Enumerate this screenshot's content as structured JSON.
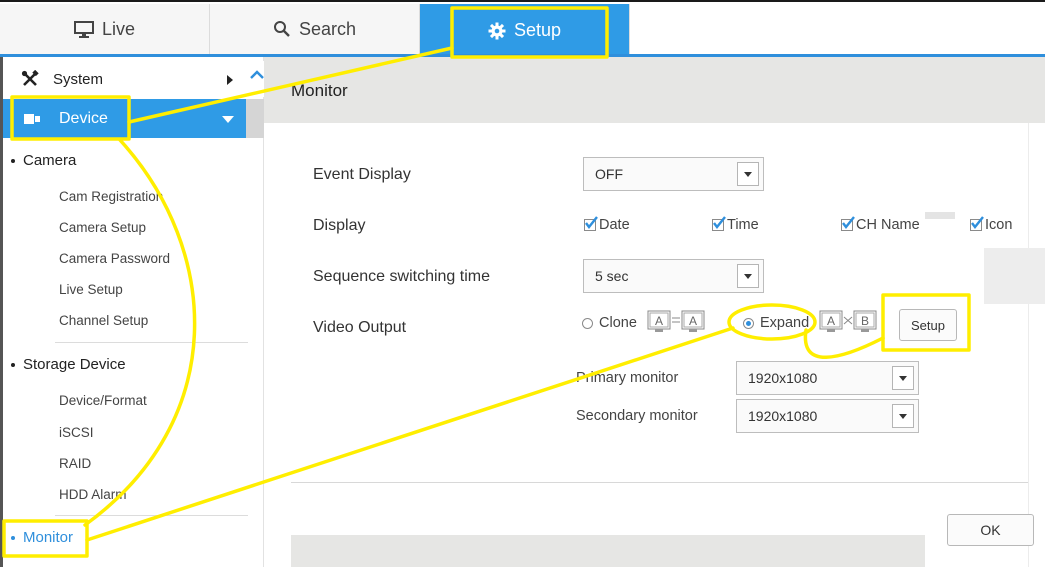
{
  "tabs": {
    "live": "Live",
    "search": "Search",
    "setup": "Setup"
  },
  "sidebar": {
    "system": "System",
    "device": "Device",
    "camera_section": "Camera",
    "camera_items": [
      "Cam Registration",
      "Camera Setup",
      "Camera Password",
      "Live Setup",
      "Channel Setup"
    ],
    "storage_section": "Storage Device",
    "storage_items": [
      "Device/Format",
      "iSCSI",
      "RAID",
      "HDD Alarm"
    ],
    "monitor_section": "Monitor"
  },
  "main": {
    "title": "Monitor",
    "event_display": {
      "label": "Event Display",
      "value": "OFF"
    },
    "display": {
      "label": "Display",
      "options": [
        "Date",
        "Time",
        "CH Name",
        "Icon"
      ]
    },
    "sequence": {
      "label": "Sequence switching time",
      "value": "5 sec"
    },
    "video_output": {
      "label": "Video Output",
      "clone": "Clone",
      "expand": "Expand",
      "selected": "Expand",
      "setup_button": "Setup",
      "icon_a": "A",
      "icon_b": "B"
    },
    "primary_monitor": {
      "label": "Primary monitor",
      "value": "1920x1080"
    },
    "secondary_monitor": {
      "label": "Secondary monitor",
      "value": "1920x1080"
    },
    "ok_button": "OK"
  },
  "colors": {
    "accent": "#2f9be6",
    "annotation": "#ffee00"
  }
}
